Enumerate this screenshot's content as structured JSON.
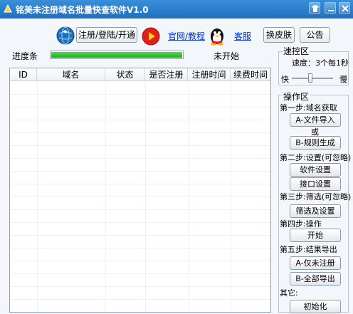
{
  "window": {
    "title": "铭美未注册域名批量快查软件V1.0"
  },
  "toolbar": {
    "register_label": "注册/登陆/开通",
    "website_link": "官网/教程",
    "support_link": "客服",
    "skin_label": "换皮肤",
    "notice_label": "公告"
  },
  "progress": {
    "label": "进度条",
    "fraction": 1.0,
    "status": "未开始"
  },
  "table": {
    "columns": [
      "ID",
      "域名",
      "状态",
      "是否注册",
      "注册时间",
      "续费时间"
    ],
    "rows": []
  },
  "speed": {
    "group_title": "速控区",
    "speed_text": "速度：3个每1秒",
    "fast_label": "快",
    "slow_label": "慢",
    "slider_level_fraction": 0.45
  },
  "ops": {
    "group_title": "操作区",
    "step1_label": "第一步:域名获取",
    "import_label": "A-文件导入",
    "or_label": "或",
    "rule_label": "B-规则生成",
    "step2_label": "第二步:设置(可忽略)",
    "software_settings_label": "软件设置",
    "api_settings_label": "接口设置",
    "step3_label": "第三步:筛选(可忽略)",
    "filter_label": "筛选及设置",
    "step4_label": "第四步:操作",
    "start_label": "开始",
    "step5_label": "第五步:结果导出",
    "export_unregistered_label": "A-仅未注册",
    "export_all_label": "B-全部导出",
    "other_label": "其它:",
    "init_label": "初始化"
  },
  "colors": {
    "title_bar": "#2a7dcc",
    "progress_fill": "#22b02a",
    "link": "#0033cc",
    "play_button": "#e0201a"
  }
}
